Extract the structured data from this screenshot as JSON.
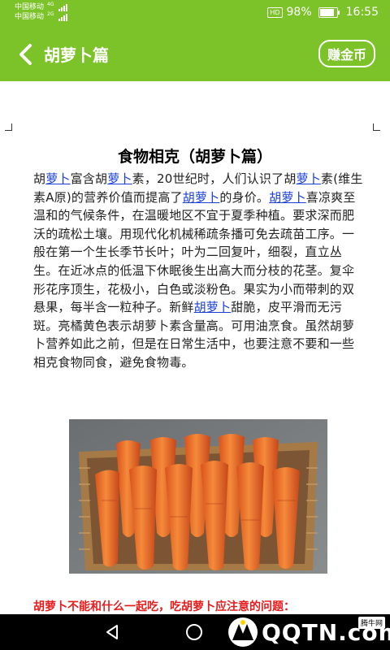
{
  "status_bar": {
    "carrier_1": "中国移动",
    "carrier_1_net": "4G",
    "carrier_2": "中国移动",
    "carrier_2_net": "2G",
    "hd_badge": "HD",
    "battery_text": "98%",
    "battery_level": 0.98,
    "time": "16:55"
  },
  "header": {
    "back_icon": "chevron-left-icon",
    "title": "胡萝卜篇",
    "coin_button": "赚金币"
  },
  "article": {
    "heading": "食物相克（胡萝卜篇）",
    "segments": [
      {
        "t": "胡"
      },
      {
        "t": "萝卜",
        "link": true
      },
      {
        "t": "富含胡"
      },
      {
        "t": "萝卜",
        "link": true
      },
      {
        "t": "素，20世纪时，人们认识了胡"
      },
      {
        "t": "萝卜",
        "link": true
      },
      {
        "t": "素(维生素A原)的营养价值而提高了"
      },
      {
        "t": "胡萝卜",
        "link": true
      },
      {
        "t": "的身价。"
      },
      {
        "t": "胡萝卜",
        "link": true
      },
      {
        "t": "喜凉爽至温和的气候条件，在温暖地区不宜于夏季种植。要求深而肥沃的疏松土壤。用现代化机械稀疏条播可免去疏苗工序。一般在第一个生长季节长叶；叶为二回复叶，细裂，直立丛生。在近冰点的低温下休眠後生出高大而分枝的花茎。复伞形花序顶生，花极小，白色或淡粉色。果实为小而带刺的双悬果，每半含一粒种子。新鲜"
      },
      {
        "t": "胡萝卜",
        "link": true
      },
      {
        "t": "甜脆，皮平滑而无污斑。亮橘黄色表示胡萝卜素含量高。可用油烹食。虽然胡萝卜营养如此之前，但是在日常生活中，也要注意不要和一些相克食物同食，避免食物毒。"
      }
    ],
    "image_alt": "carrots-in-basket",
    "warning_title": "胡萝卜不能和什么一起吃，吃胡萝卜应注意的问题："
  },
  "nav_bar": {
    "back_icon": "triangle-back-icon",
    "home_icon": "circle-home-icon",
    "recents_icon": "square-recents-icon",
    "watermark_text": "QQTN.com",
    "watermark_badge": "腾牛网"
  },
  "colors": {
    "brand_green": "#7cc229",
    "link_blue": "#1a3fd6",
    "warning_red": "#e51c1c"
  }
}
